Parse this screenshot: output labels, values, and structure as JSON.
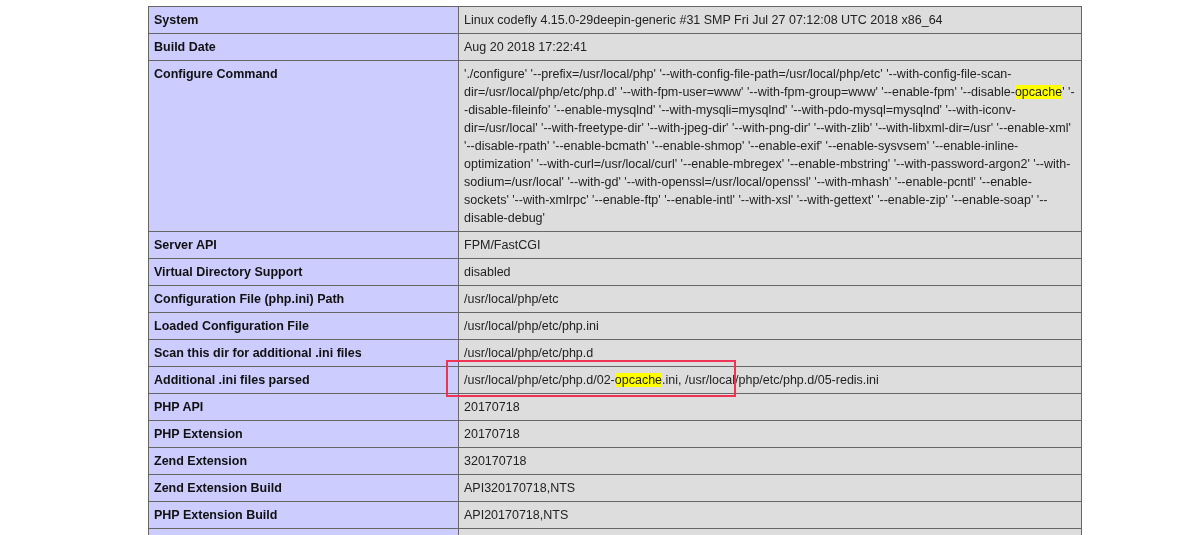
{
  "table": {
    "rows": [
      {
        "label": "System",
        "value": [
          {
            "text": "Linux codefly 4.15.0-29deepin-generic #31 SMP Fri Jul 27 07:12:08 UTC 2018 x86_64",
            "highlighted": false
          }
        ]
      },
      {
        "label": "Build Date",
        "value": [
          {
            "text": "Aug 20 2018 17:22:41",
            "highlighted": false
          }
        ]
      },
      {
        "label": "Configure Command",
        "value": [
          {
            "text": "'./configure' '--prefix=/usr/local/php' '--with-config-file-path=/usr/local/php/etc' '--with-config-file-scan-dir=/usr/local/php/etc/php.d' '--with-fpm-user=www' '--with-fpm-group=www' '--enable-fpm' '--disable-",
            "highlighted": false
          },
          {
            "text": "opcache",
            "highlighted": true
          },
          {
            "text": "' '--disable-fileinfo' '--enable-mysqlnd' '--with-mysqli=mysqlnd' '--with-pdo-mysql=mysqlnd' '--with-iconv-dir=/usr/local' '--with-freetype-dir' '--with-jpeg-dir' '--with-png-dir' '--with-zlib' '--with-libxml-dir=/usr' '--enable-xml' '--disable-rpath' '--enable-bcmath' '--enable-shmop' '--enable-exif' '--enable-sysvsem' '--enable-inline-optimization' '--with-curl=/usr/local/curl' '--enable-mbregex' '--enable-mbstring' '--with-password-argon2' '--with-sodium=/usr/local' '--with-gd' '--with-openssl=/usr/local/openssl' '--with-mhash' '--enable-pcntl' '--enable-sockets' '--with-xmlrpc' '--enable-ftp' '--enable-intl' '--with-xsl' '--with-gettext' '--enable-zip' '--enable-soap' '--disable-debug'",
            "highlighted": false
          }
        ]
      },
      {
        "label": "Server API",
        "value": [
          {
            "text": "FPM/FastCGI",
            "highlighted": false
          }
        ]
      },
      {
        "label": "Virtual Directory Support",
        "value": [
          {
            "text": "disabled",
            "highlighted": false
          }
        ]
      },
      {
        "label": "Configuration File (php.ini) Path",
        "value": [
          {
            "text": "/usr/local/php/etc",
            "highlighted": false
          }
        ]
      },
      {
        "label": "Loaded Configuration File",
        "value": [
          {
            "text": "/usr/local/php/etc/php.ini",
            "highlighted": false
          }
        ]
      },
      {
        "label": "Scan this dir for additional .ini files",
        "value": [
          {
            "text": "/usr/local/php/etc/php.d",
            "highlighted": false
          }
        ]
      },
      {
        "label": "Additional .ini files parsed",
        "value": [
          {
            "text": "/usr/local/php/etc/php.d/02-",
            "highlighted": false
          },
          {
            "text": "opcache",
            "highlighted": true
          },
          {
            "text": ".ini, /usr/local/php/etc/php.d/05-redis.ini",
            "highlighted": false
          }
        ]
      },
      {
        "label": "PHP API",
        "value": [
          {
            "text": "20170718",
            "highlighted": false
          }
        ]
      },
      {
        "label": "PHP Extension",
        "value": [
          {
            "text": "20170718",
            "highlighted": false
          }
        ]
      },
      {
        "label": "Zend Extension",
        "value": [
          {
            "text": "320170718",
            "highlighted": false
          }
        ]
      },
      {
        "label": "Zend Extension Build",
        "value": [
          {
            "text": "API320170718,NTS",
            "highlighted": false
          }
        ]
      },
      {
        "label": "PHP Extension Build",
        "value": [
          {
            "text": "API20170718,NTS",
            "highlighted": false
          }
        ]
      }
    ]
  }
}
